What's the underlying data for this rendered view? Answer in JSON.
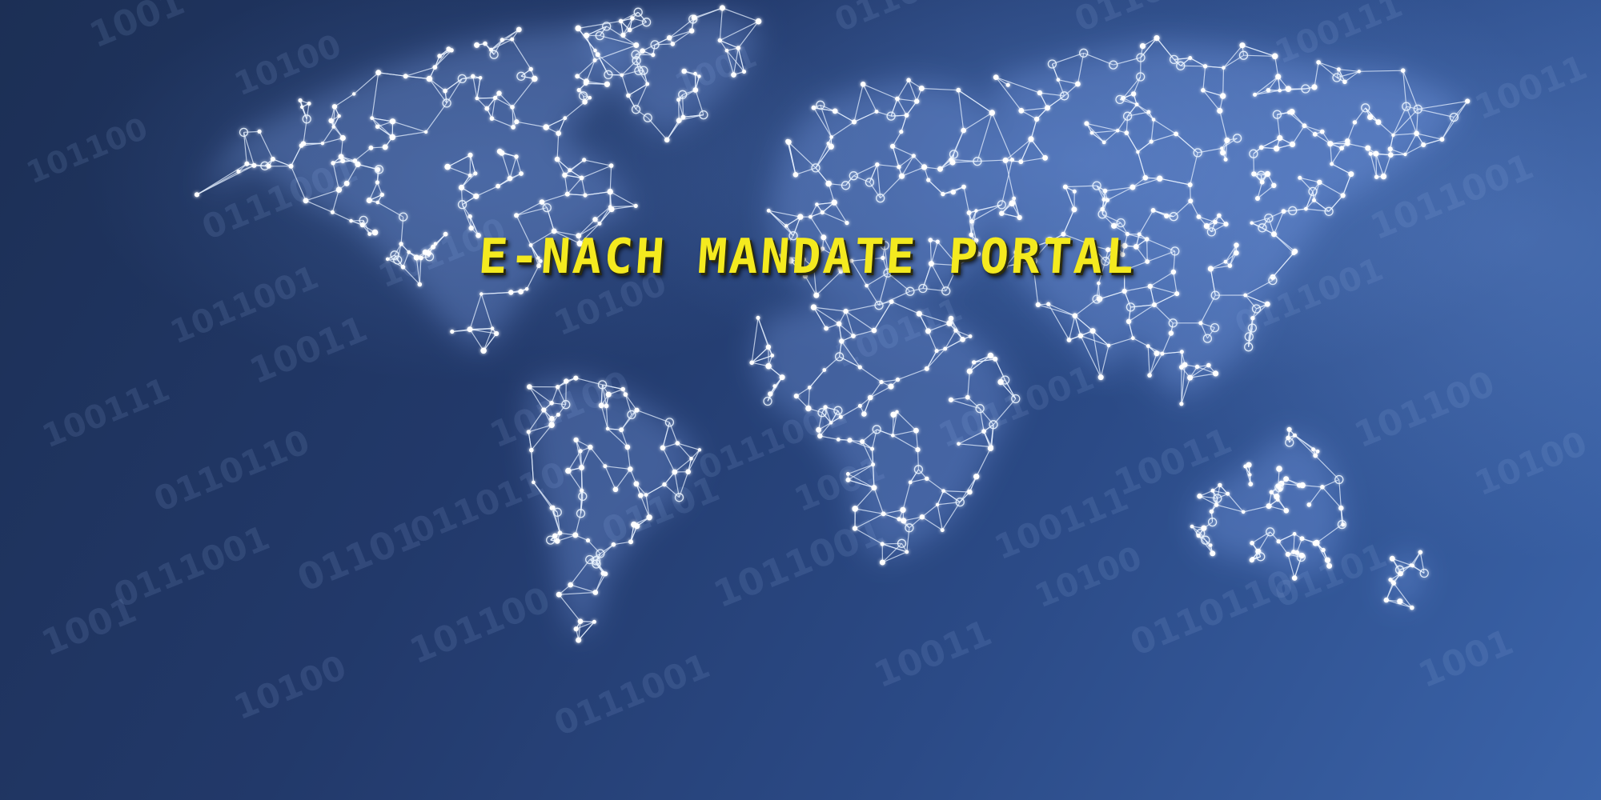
{
  "page": {
    "title": "E-NACH MANDATE PORTAL"
  },
  "background": {
    "binary_strings": [
      "1001",
      "10100",
      "101100",
      "0111001",
      "1011001",
      "10011",
      "100111",
      "0110110",
      "01101"
    ],
    "colors": {
      "deep_navy": "#1c2f55",
      "mid_blue": "#2b4a86",
      "light_blue": "#3b64aa",
      "title_yellow": "#f4ea1f"
    }
  },
  "world_map": {
    "style": "network-nodes-and-lines",
    "regions": [
      "north-america",
      "greenland",
      "south-america",
      "europe",
      "africa",
      "asia",
      "australia",
      "new-zealand"
    ]
  }
}
